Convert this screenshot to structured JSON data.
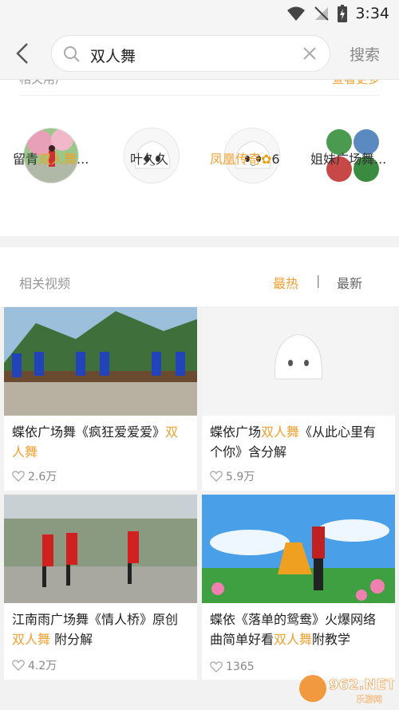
{
  "status": {
    "time": "3:34"
  },
  "search": {
    "query": "双人舞",
    "button": "搜索"
  },
  "related_users": {
    "header": "相关用户",
    "more": "查看更多",
    "users": [
      {
        "pre": "留青",
        "hl": "双人舞",
        "post": "..."
      },
      {
        "pre": "叶久久",
        "hl": "",
        "post": ""
      },
      {
        "pre": "",
        "hl": "凤凰传奇",
        "post": "6"
      },
      {
        "pre": "姐妹广场舞...",
        "hl": "",
        "post": ""
      }
    ]
  },
  "videos": {
    "header": "相关视频",
    "sort_hot": "最热",
    "sort_sep": "|",
    "sort_new": "最新",
    "items": [
      {
        "pre": "蝶依广场舞《疯狂爱爱爱》",
        "hl": "双人舞",
        "post": "",
        "likes": "2.6万"
      },
      {
        "pre": "蝶依广场",
        "hl": "双人舞",
        "post": "《从此心里有个你》含分解",
        "likes": "5.9万"
      },
      {
        "pre": "江南雨广场舞《情人桥》原创 ",
        "hl": "双人舞",
        "post": " 附分解",
        "likes": "4.2万"
      },
      {
        "pre": "蝶依《落单的鸳鸯》火爆网络曲简单好看",
        "hl": "双人舞",
        "post": "附教学",
        "likes": "1365"
      }
    ]
  },
  "watermark": {
    "logo": "962.NET",
    "sub": "乐游网"
  },
  "colors": {
    "accent": "#f0a030",
    "bg": "#f2f2f2"
  }
}
